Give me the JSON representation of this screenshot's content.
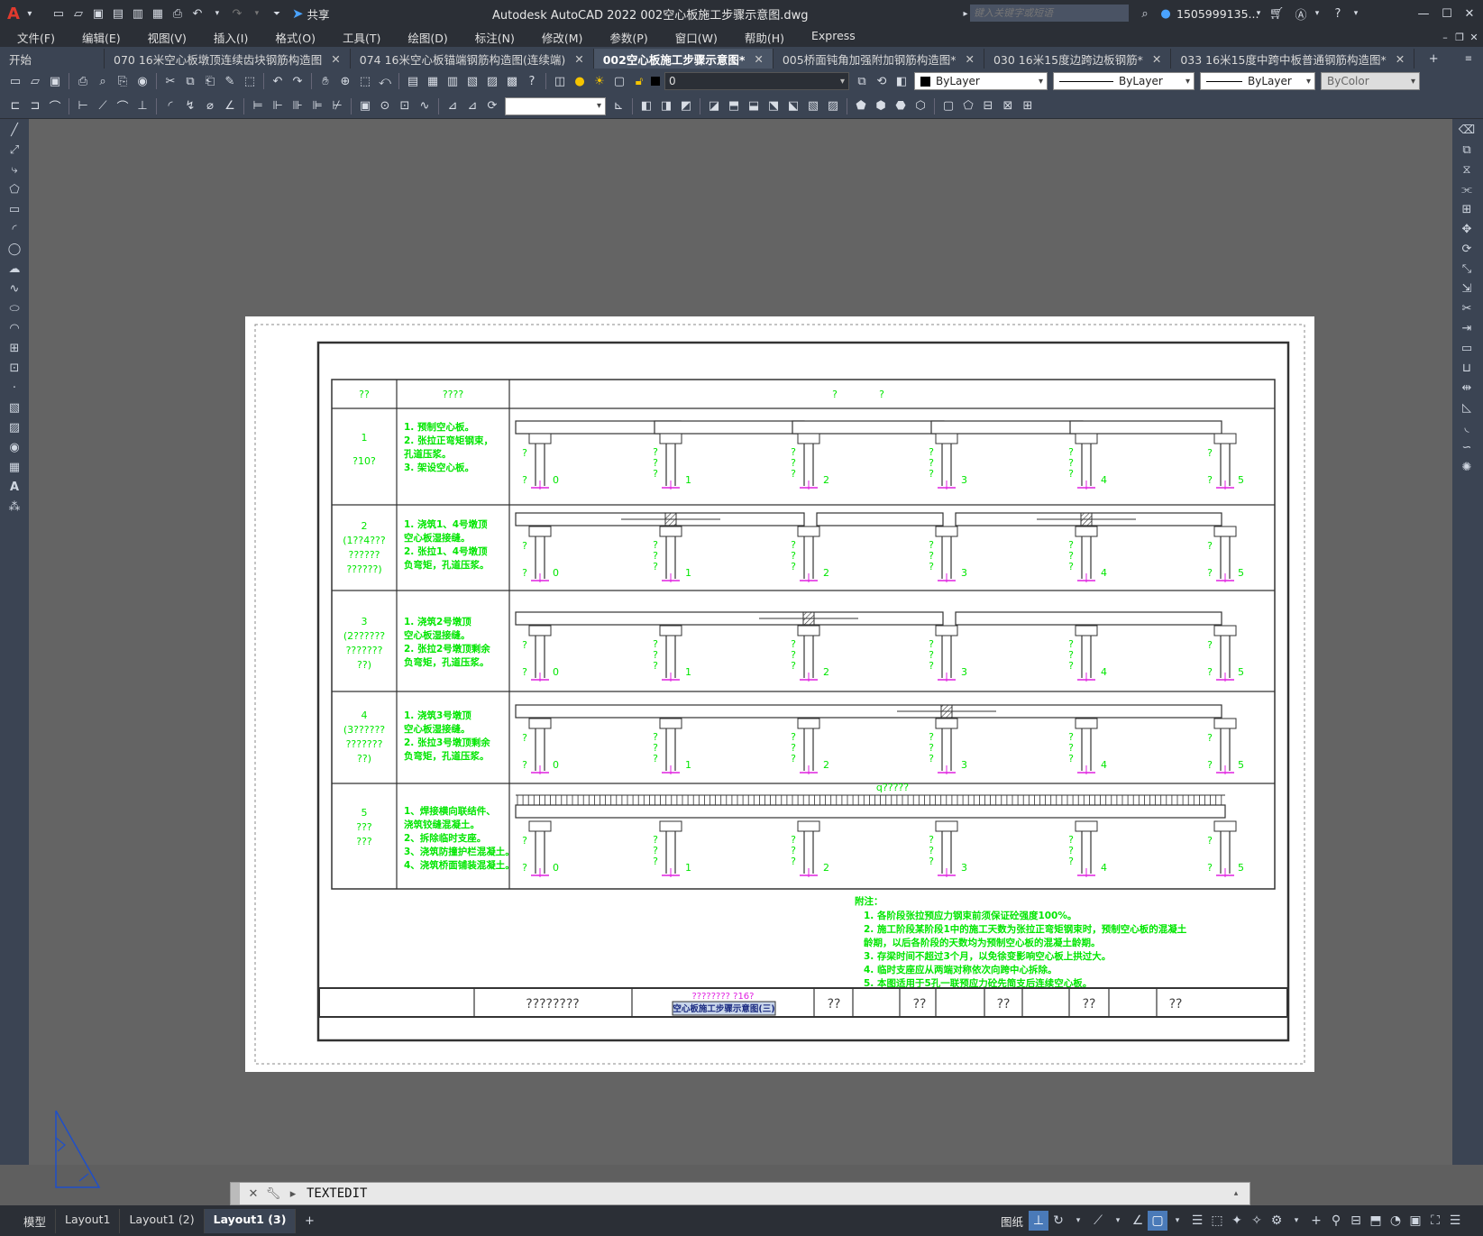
{
  "titlebar": {
    "title": "Autodesk AutoCAD 2022    002空心板施工步骤示意图.dwg",
    "share_label": "共享",
    "search_placeholder": "键入关键字或短语",
    "user": "1505999135...",
    "colors": {
      "logo": "#e03a2e",
      "share": "#4aa3ff"
    }
  },
  "menu": [
    "文件(F)",
    "编辑(E)",
    "视图(V)",
    "插入(I)",
    "格式(O)",
    "工具(T)",
    "绘图(D)",
    "标注(N)",
    "修改(M)",
    "参数(P)",
    "窗口(W)",
    "帮助(H)",
    "Express"
  ],
  "tabs": [
    {
      "label": "开始",
      "closable": false
    },
    {
      "label": "070 16米空心板墩顶连续齿块钢筋构造图",
      "closable": true
    },
    {
      "label": "074  16米空心板锚端钢筋构造图(连续端)",
      "closable": true
    },
    {
      "label": "002空心板施工步骤示意图*",
      "closable": true,
      "active": true
    },
    {
      "label": "005桥面钝角加强附加钢筋构造图*",
      "closable": true
    },
    {
      "label": "030 16米15度边跨边板钢筋*",
      "closable": true
    },
    {
      "label": "033 16米15度中跨中板普通钢筋构造图*",
      "closable": true
    }
  ],
  "properties": {
    "layer": "0",
    "color": "ByLayer",
    "linetype": "ByLayer",
    "lineweight": "ByLayer",
    "plotstyle": "ByColor"
  },
  "drawing": {
    "header": {
      "col1": "??",
      "col2": "????",
      "col3_a": "?",
      "col3_b": "?"
    },
    "rows": [
      {
        "step": [
          "1",
          "?10?"
        ],
        "desc": [
          "1. 预制空心板。",
          "2. 张拉正弯矩钢束，",
          "    孔道压浆。",
          "3. 架设空心板。"
        ]
      },
      {
        "step": [
          "2",
          "(1??4???",
          "??????",
          "??????)"
        ],
        "desc": [
          "1. 浇筑1、4号墩顶",
          "    空心板湿接缝。",
          "2. 张拉1、4号墩顶",
          "    负弯矩，孔道压浆。"
        ]
      },
      {
        "step": [
          "3",
          "(2??????",
          "???????",
          "??)"
        ],
        "desc": [
          "1. 浇筑2号墩顶",
          "    空心板湿接缝。",
          "2. 张拉2号墩顶剩余",
          "    负弯矩，孔道压浆。"
        ]
      },
      {
        "step": [
          "4",
          "(3??????",
          "???????",
          "??)"
        ],
        "desc": [
          "1. 浇筑3号墩顶",
          "    空心板湿接缝。",
          "2. 张拉3号墩顶剩余",
          "    负弯矩，孔道压浆。"
        ]
      },
      {
        "step": [
          "5",
          "???",
          "???"
        ],
        "desc": [
          "1、焊接横向联结件、",
          "    浇筑铰缝混凝土。",
          "2、拆除临时支座。",
          "3、浇筑防撞护栏混凝土。",
          "4、浇筑桥面铺装混凝土。"
        ]
      }
    ],
    "pier_labels": [
      "0",
      "1",
      "2",
      "3",
      "4",
      "5"
    ],
    "load_label": "q?????",
    "notes_title": "附注：",
    "notes": [
      "1. 各阶段张拉预应力钢束前须保证砼强度100%。",
      "2. 施工阶段某阶段1中的施工天数为张拉正弯矩钢束时，预制空心板的混凝土",
      "    龄期，以后各阶段的天数均为预制空心板的混凝土龄期。",
      "3. 存梁时间不超过3个月，以免徐变影响空心板上拱过大。",
      "4. 临时支座应从两端对称依次向跨中心拆除。",
      "5. 本图适用于5孔一联预应力砼先简支后连续空心板。"
    ],
    "titleblock": {
      "project": "????????",
      "name_top": "????????  ?16?",
      "name_selected": "空心板施工步骤示意图(三)",
      "fields": [
        "??",
        "??",
        "??",
        "??",
        "??"
      ]
    },
    "colors": {
      "text": "#00e600",
      "anchor": "#e020e0",
      "lines": "#333333"
    }
  },
  "command": {
    "text": "TEXTEDIT"
  },
  "layout_tabs": [
    "模型",
    "Layout1",
    "Layout1 (2)",
    "Layout1 (3)"
  ],
  "active_layout": "Layout1 (3)",
  "status": {
    "paper_label": "图纸"
  }
}
